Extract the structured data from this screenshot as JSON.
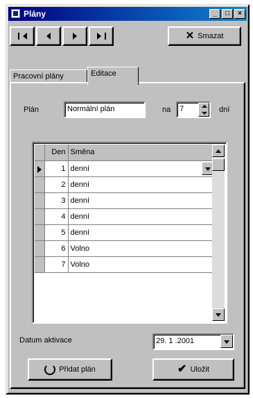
{
  "window": {
    "title": "Plány"
  },
  "titlebar_buttons": {
    "minimize": "_",
    "maximize": "□",
    "close": "×"
  },
  "toolbar": {
    "delete_label": "Smazat"
  },
  "tabs": [
    {
      "label": "Pracovní plány"
    },
    {
      "label": "Editace"
    }
  ],
  "form": {
    "plan_label": "Plán",
    "plan_value": "Normální plán",
    "na_label": "na",
    "days_value": "7",
    "days_unit": "dní"
  },
  "grid": {
    "columns": [
      "Den",
      "Směna"
    ],
    "rows": [
      {
        "den": "1",
        "smena": "denní"
      },
      {
        "den": "2",
        "smena": "denní"
      },
      {
        "den": "3",
        "smena": "denní"
      },
      {
        "den": "4",
        "smena": "denní"
      },
      {
        "den": "5",
        "smena": "denní"
      },
      {
        "den": "6",
        "smena": "Volno"
      },
      {
        "den": "7",
        "smena": "Volno"
      }
    ]
  },
  "activation": {
    "label": "Datum aktivace",
    "date": "29. 1 .2001"
  },
  "actions": {
    "add_plan": "Přidat plán",
    "save": "Uložit"
  }
}
